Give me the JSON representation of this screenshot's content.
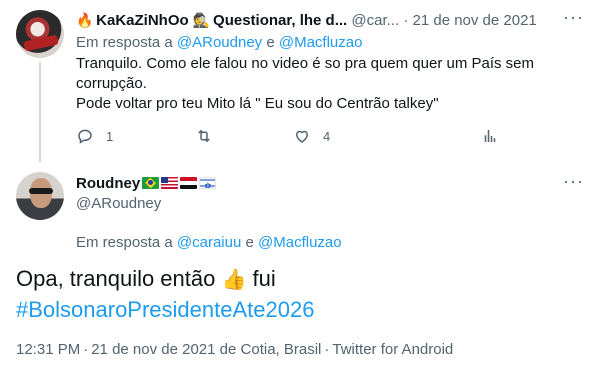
{
  "tweet1": {
    "display_name": "KaKaZiNhOo",
    "name_suffix": "Questionar, lhe d...",
    "handle": "@car...",
    "separator": "·",
    "date": "21 de nov de 2021",
    "reply_prefix": "Em resposta a",
    "reply_user1": "@ARoudney",
    "reply_conj": "e",
    "reply_user2": "@Macfluzao",
    "text_line1": "Tranquilo. Como ele falou no video é so pra quem quer um País sem corrupção.",
    "text_line2": "Pode voltar pro teu Mito lá \" Eu sou do Centrão talkey\"",
    "reply_count": "1",
    "like_count": "4",
    "icons": [
      "reply-icon",
      "retweet-icon",
      "like-icon",
      "analytics-icon",
      "more-icon"
    ]
  },
  "tweet2": {
    "display_name": "Roudney",
    "flags": [
      "brazil-flag",
      "usa-flag",
      "egypt-flag",
      "israel-flag"
    ],
    "handle": "@ARoudney",
    "reply_prefix": "Em resposta a",
    "reply_user1": "@caraiuu",
    "reply_conj": "e",
    "reply_user2": "@Macfluzao",
    "text_main": "Opa, tranquilo então",
    "emoji": "👍",
    "text_after_emoji": "fui",
    "hashtag": "#BolsonaroPresidenteAte2026",
    "time": "12:31 PM",
    "date_location": "21 de nov de 2021 de Cotia, Brasil",
    "client": "Twitter for Android",
    "separator": "·"
  },
  "colors": {
    "text": "#0f1419",
    "secondary": "#536471",
    "link": "#1d9bf0",
    "border": "#cfd9de"
  }
}
